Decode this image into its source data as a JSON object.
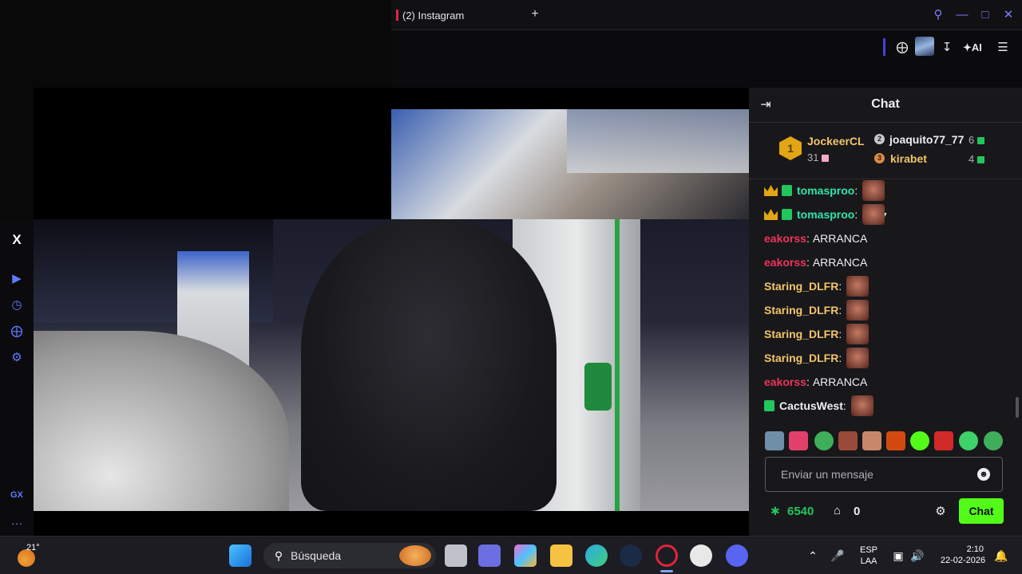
{
  "browser": {
    "tab_title": "(2) Instagram",
    "new_tab_icon": "plus-icon",
    "ai_label": "AI"
  },
  "sidebar": {
    "items": [
      "x-icon",
      "play-icon",
      "history-icon",
      "extensions-icon",
      "settings-icon",
      "gx-icon",
      "more-icon"
    ],
    "gx_label": "GX",
    "more_label": "…"
  },
  "chat": {
    "title": "Chat",
    "leaderboard": [
      {
        "rank": "1",
        "name": "JockeerCL",
        "count": "31",
        "color": "#f3c46a"
      },
      {
        "rank": "2",
        "name": "joaquito77_77",
        "count": "6",
        "color": "#efeff1"
      },
      {
        "rank": "3",
        "name": "kirabet",
        "count": "4",
        "color": "#f3c46a"
      }
    ],
    "messages": [
      {
        "user": "tomasproo",
        "text": "",
        "color": "#2ee6a6",
        "badges": [
          "crown",
          "gift"
        ],
        "emote": true
      },
      {
        "user": "tomasproo",
        "text": "",
        "color": "#2ee6a6",
        "badges": [
          "crown",
          "gift"
        ],
        "emote": true
      },
      {
        "user": "eakorss",
        "text": "ARRANCA",
        "color": "#f0325a",
        "badges": [],
        "emote": false
      },
      {
        "user": "eakorss",
        "text": "ARRANCA",
        "color": "#f0325a",
        "badges": [],
        "emote": false
      },
      {
        "user": "Staring_DLFR",
        "text": "",
        "color": "#f3c46a",
        "badges": [],
        "emote": true
      },
      {
        "user": "Staring_DLFR",
        "text": "",
        "color": "#f3c46a",
        "badges": [],
        "emote": true
      },
      {
        "user": "Staring_DLFR",
        "text": "",
        "color": "#f3c46a",
        "badges": [],
        "emote": true
      },
      {
        "user": "Staring_DLFR",
        "text": "",
        "color": "#f3c46a",
        "badges": [],
        "emote": true
      },
      {
        "user": "eakorss",
        "text": "ARRANCA",
        "color": "#f0325a",
        "badges": [],
        "emote": false
      },
      {
        "user": "CactusWest",
        "text": "",
        "color": "#efeff1",
        "badges": [
          "gift"
        ],
        "emote": true
      }
    ],
    "input_placeholder": "Enviar un mensaje",
    "points": "6540",
    "store_count": "0",
    "send_label": "Chat",
    "accent": "#53fc18"
  },
  "taskbar": {
    "temperature": "21°",
    "search_label": "Búsqueda",
    "lang_top": "ESP",
    "lang_bottom": "LAA",
    "time": "2:10",
    "date": "22-02-2026"
  }
}
